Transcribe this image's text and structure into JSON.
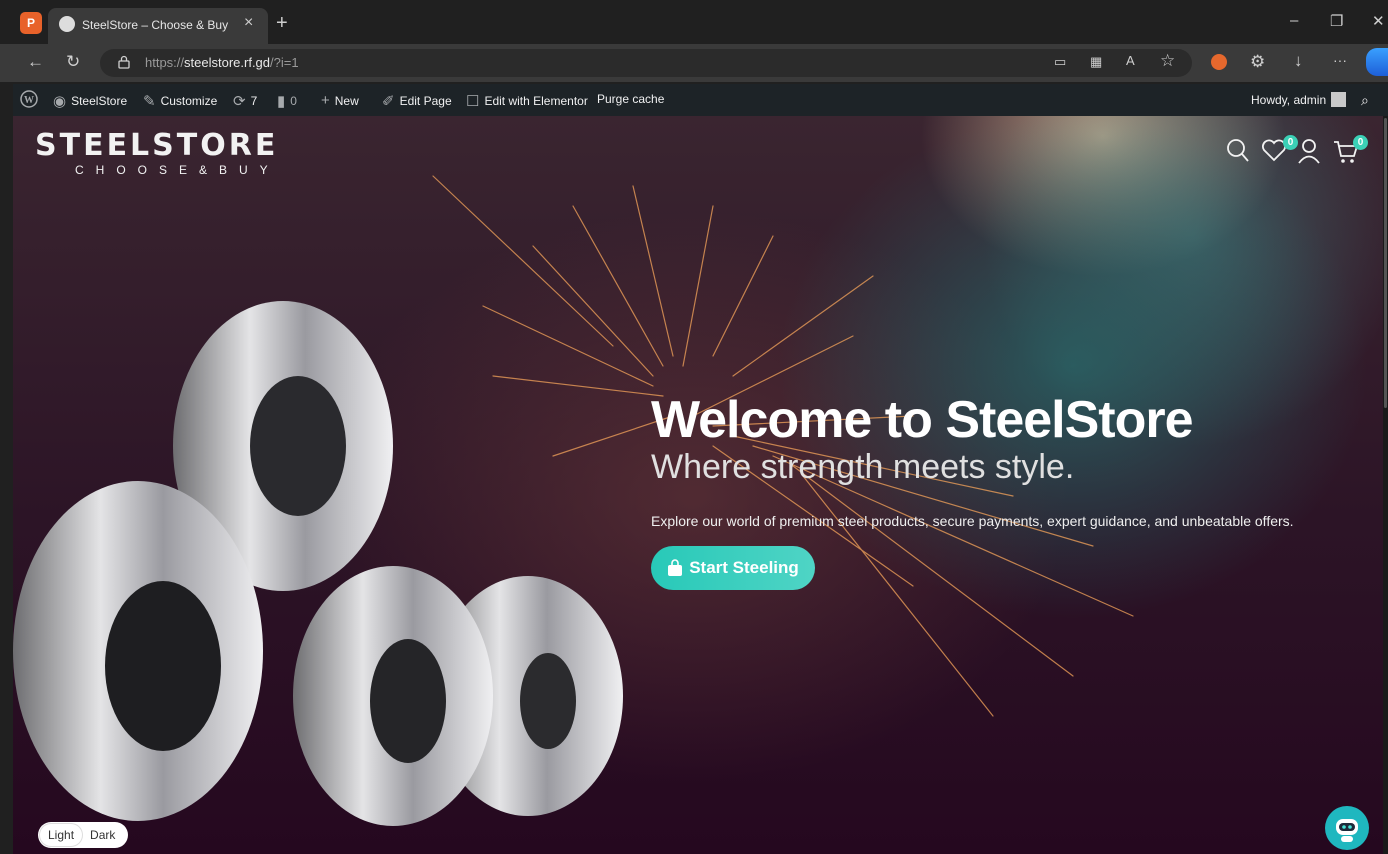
{
  "browser": {
    "tab_title": "SteelStore – Choose & Buy",
    "tab_close": "×",
    "new_tab": "+",
    "window_controls": {
      "minimize": "–",
      "restore": "❐",
      "close": "✕"
    },
    "url_scheme": "https://",
    "url_host": "steelstore.rf.gd",
    "url_path": "/?i=1",
    "more_menu": "···"
  },
  "admin_bar": {
    "site_name": "SteelStore",
    "customize": "Customize",
    "updates_count": "7",
    "comments_count": "0",
    "new": "New",
    "edit_page": "Edit Page",
    "edit_elementor": "Edit with Elementor",
    "purge_cache": "Purge cache",
    "howdy": "Howdy, admin"
  },
  "site": {
    "brand_main": "STEELSTORE",
    "brand_sub": "CHOOSE&BUY",
    "wishlist_count": "0",
    "cart_count": "0"
  },
  "hero": {
    "title": "Welcome to SteelStore",
    "subtitle": "Where strength meets style.",
    "lead": "Explore our world of premium steel products, secure payments, expert guidance, and unbeatable offers.",
    "cta_label": "Start Steeling"
  },
  "theme_toggle": {
    "light": "Light",
    "dark": "Dark",
    "selected": "Light"
  },
  "colors": {
    "accent": "#2ec9b6",
    "admin_bar": "#1d2327",
    "badge": "#3bd0b6"
  }
}
